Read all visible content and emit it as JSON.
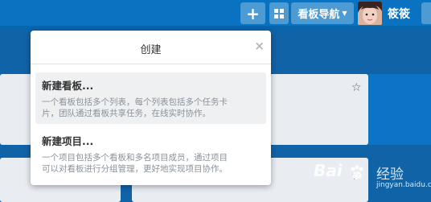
{
  "topbar": {
    "plus_icon": "+",
    "nav_label": "看板导航",
    "username": "筱筱"
  },
  "popover": {
    "title": "创建",
    "close_icon": "×",
    "items": [
      {
        "title": "新建看板...",
        "description_line1": "一个看板包括多个列表，每个列表包括多个任务卡",
        "description_line2": "片，团队通过看板共享任务，在线实时协作。"
      },
      {
        "title": "新建项目...",
        "description_line1": "一个项目包括多个看板和多名项目成员，通过项目",
        "description_line2": "可以对看板进行分组管理，更好地实现项目协作。"
      }
    ]
  },
  "background": {
    "star_icon": "☆"
  },
  "watermark": {
    "logo": "Bai",
    "text": "经验",
    "sub": "jingyan.baidu.com"
  },
  "colors": {
    "topbar": "#0a73c1",
    "background": "#0b74c4",
    "card": "#e9edf2"
  }
}
